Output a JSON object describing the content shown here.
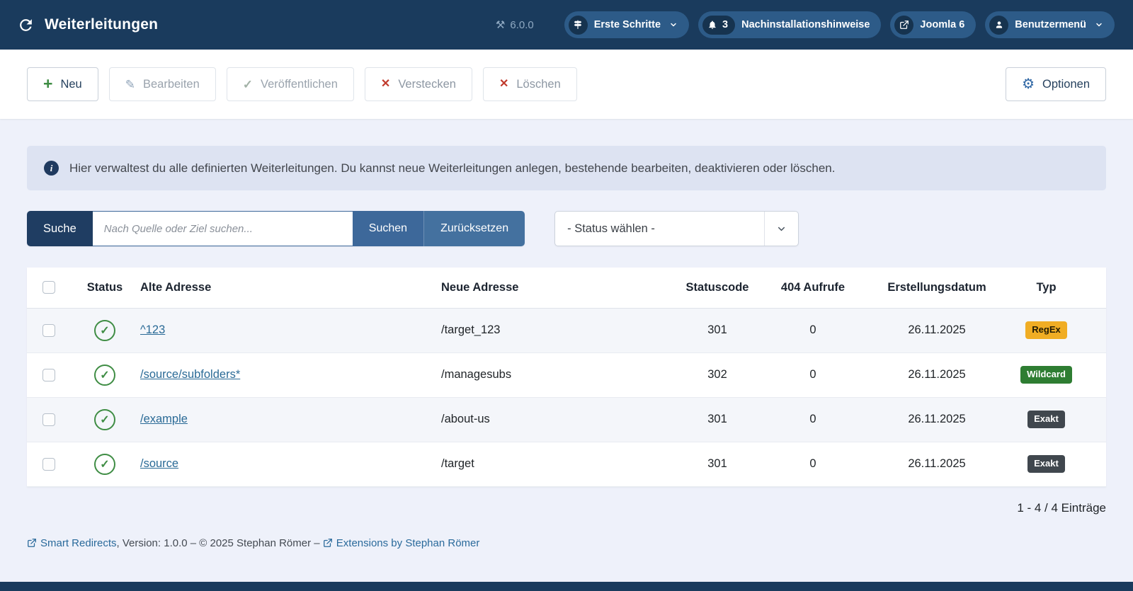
{
  "navbar": {
    "title": "Weiterleitungen",
    "version": "6.0.0",
    "erste_schritte": "Erste Schritte",
    "notifications_count": "3",
    "notifications_label": "Nachinstallationshinweise",
    "joomla_label": "Joomla 6",
    "user_label": "Benutzermenü"
  },
  "toolbar": {
    "new": "Neu",
    "edit": "Bearbeiten",
    "publish": "Veröffentlichen",
    "hide": "Verstecken",
    "delete": "Löschen",
    "options": "Optionen"
  },
  "alert": {
    "text": "Hier verwaltest du alle definierten Weiterleitungen. Du kannst neue Weiterleitungen anlegen, bestehende bearbeiten, deaktivieren oder löschen."
  },
  "search": {
    "label": "Suche",
    "placeholder": "Nach Quelle oder Ziel suchen...",
    "submit": "Suchen",
    "reset": "Zurücksetzen",
    "status_filter": "- Status wählen -"
  },
  "table": {
    "headers": [
      "Status",
      "Alte Adresse",
      "Neue Adresse",
      "Statuscode",
      "404 Aufrufe",
      "Erstellungsdatum",
      "Typ"
    ],
    "rows": [
      {
        "old": "^123",
        "new": "/target_123",
        "code": 301,
        "hits": 0,
        "date": "26.11.2025",
        "type": "RegEx",
        "type_variant": "regex"
      },
      {
        "old": "/source/subfolders*",
        "new": "/managesubs",
        "code": 302,
        "hits": 0,
        "date": "26.11.2025",
        "type": "Wildcard",
        "type_variant": "wildcard"
      },
      {
        "old": "/example",
        "new": "/about-us",
        "code": 301,
        "hits": 0,
        "date": "26.11.2025",
        "type": "Exakt",
        "type_variant": "exact"
      },
      {
        "old": "/source",
        "new": "/target",
        "code": 301,
        "hits": 0,
        "date": "26.11.2025",
        "type": "Exakt",
        "type_variant": "exact"
      }
    ]
  },
  "pagination": {
    "text": "1 - 4 / 4 Einträge"
  },
  "footer": {
    "link1": "Smart Redirects",
    "middle": ", Version: 1.0.0 – © 2025 Stephan Römer – ",
    "link2": "Extensions by Stephan Römer"
  },
  "colors": {
    "navbar_bg": "#1a3b5d",
    "pill_bg": "#2d5b88",
    "primary_blue": "#3d689a",
    "success_green": "#3f8d44",
    "danger_red": "#c0392b",
    "badge_regex": "#f0ad24",
    "badge_wildcard": "#2e7d32",
    "badge_exact": "#40474e",
    "link": "#2a6a96"
  }
}
